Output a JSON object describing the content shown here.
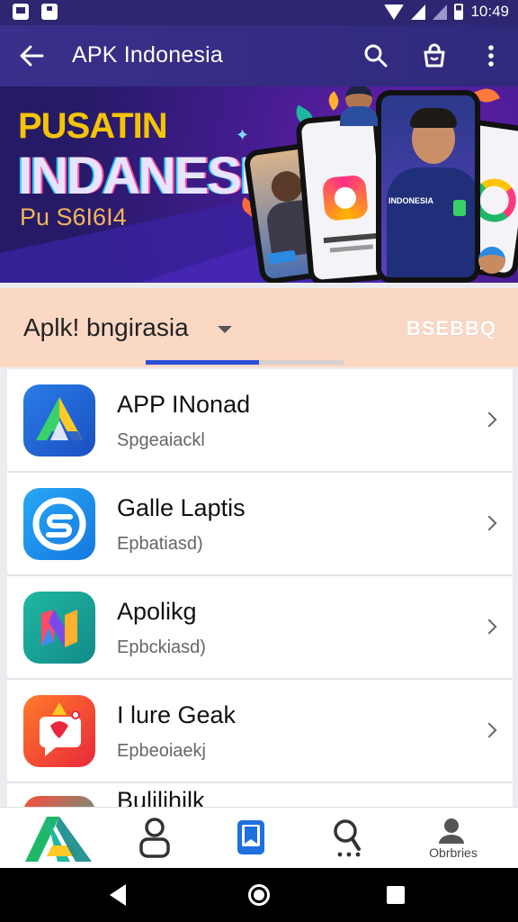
{
  "status_bar": {
    "time": "10:49",
    "icons": [
      "image-icon",
      "sd-card-icon",
      "wifi-icon",
      "signal-icon",
      "battery-icon"
    ]
  },
  "app_bar": {
    "title": "APK Indonesia",
    "icons": [
      "back-arrow-icon",
      "search-icon",
      "shopping-bag-icon",
      "more-vert-icon"
    ]
  },
  "banner": {
    "line1": "PUSATIN",
    "line2": "INDANESIA",
    "line3": "Pu S6I6I4",
    "shirt_text": "INDONESIA"
  },
  "category": {
    "title": "Aplk! bngirasia",
    "code": "BSEBBQ"
  },
  "apps": [
    {
      "name": "APP INonad",
      "subtitle": "Spgeaiackl",
      "icon": "triangle-app-icon"
    },
    {
      "name": "Galle Laptis",
      "subtitle": "Epbatiasd)",
      "icon": "blue-s-app-icon"
    },
    {
      "name": "Apolikg",
      "subtitle": "Epbckiasd)",
      "icon": "colorful-n-app-icon"
    },
    {
      "name": "I lure Geak",
      "subtitle": "Epbeoiaekj",
      "icon": "chat-bubble-app-icon"
    },
    {
      "name": "Bulilihilk",
      "subtitle": "",
      "icon": "partial-app-icon"
    }
  ],
  "bottom_nav": {
    "items": [
      "home-logo-icon",
      "profile-icon",
      "bookmark-icon",
      "search-icon",
      "account-icon"
    ],
    "last_label": "Obrbries"
  },
  "colors": {
    "app_bar": "#3a2f8a",
    "category_bg": "#fbd8c4",
    "tab_indicator": "#2a4fd8",
    "active_nav": "#1e6fe0"
  }
}
